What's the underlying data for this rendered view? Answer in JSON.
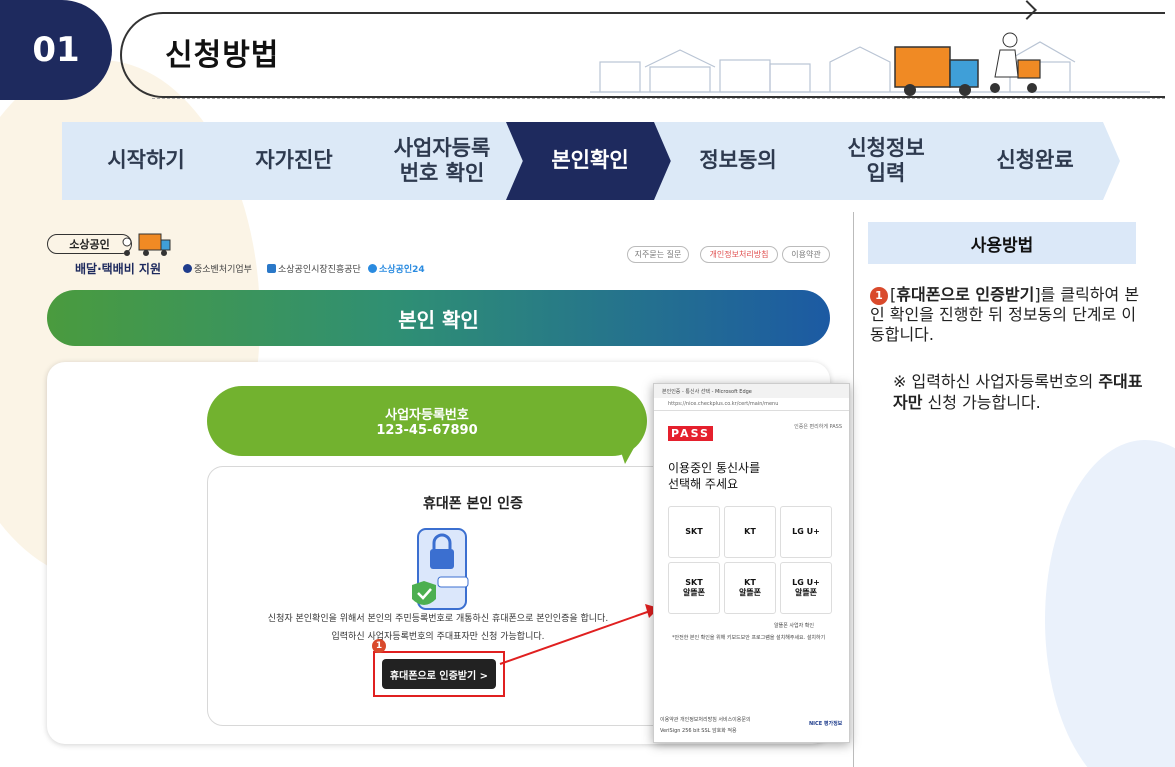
{
  "header": {
    "section_number": "01",
    "title": "신청방법"
  },
  "steps": [
    {
      "label": "시작하기",
      "active": false
    },
    {
      "label": "자가진단",
      "active": false
    },
    {
      "label": "사업자등록\n번호 확인",
      "active": false
    },
    {
      "label": "본인확인",
      "active": true
    },
    {
      "label": "정보동의",
      "active": false
    },
    {
      "label": "신청정보\n입력",
      "active": false
    },
    {
      "label": "신청완료",
      "active": false
    }
  ],
  "site": {
    "brand": "소상공인",
    "brand_sub": "배달·택배비 지원",
    "orgs": [
      "중소벤처기업부",
      "소상공인시장진흥공단",
      "소상공인24"
    ],
    "top_links": [
      "지주묻는 질문",
      "개인정보처리방침",
      "이용약관"
    ],
    "banner_title": "본인 확인",
    "bubble_label": "사업자등록번호",
    "business_number": "123-45-67890",
    "card_title": "휴대폰 본인 인증",
    "desc_line1": "신청자 본인확인을 위해서 본인의 주민등록번호로 개통하신 휴대폰으로 본인인증을 합니다.",
    "desc_line2": "입력하신 사업자등록번호의 주대표자만 신청 가능합니다.",
    "auth_button": "휴대폰으로 인증받기 >",
    "marker": "1"
  },
  "popup": {
    "window_title": "본인인증 - 통신사 선택 - Microsoft Edge",
    "url": "https://nice.checkplus.co.kr/cert/main/menu",
    "logo": "PASS",
    "note": "인증은 편리하게 PASS",
    "select_title_line1": "이용중인 통신사를",
    "select_title_line2": "선택해 주세요",
    "carriers": [
      "SKT",
      "KT",
      "LG U+",
      "SKT\n알뜰폰",
      "KT\n알뜰폰",
      "LG U+\n알뜰폰"
    ],
    "mvno_check": "알뜰폰 사업자 확인",
    "notice": "*안전한 본인 확인을 위해 키보드보안 프로그램을 설치해주세요. 설치하기",
    "footer_line1": "이용약관 개인정보처리방침 서비스이용문의",
    "footer_line2": "VeriSign 256 bit SSL 암호화 적용",
    "footer_brand": "NICE 평가정보"
  },
  "howto": {
    "title": "사용방법",
    "marker": "1",
    "step_bold": "휴대폰으로 인증받기",
    "step_text_before": "[",
    "step_text_after": "]를 클릭하여 본인 확인을 진행한 뒤 정보동의 단계로 이동합니다.",
    "note_prefix": "※ 입력하신 사업자등록번호의",
    "note_bold": "주대표자만",
    "note_suffix": " 신청 가능합니다."
  },
  "colors": {
    "navy": "#1e2a5e",
    "step_inactive": "#dce9f7",
    "accent_red": "#e02020",
    "marker": "#d94a2c",
    "green": "#72b22f"
  }
}
